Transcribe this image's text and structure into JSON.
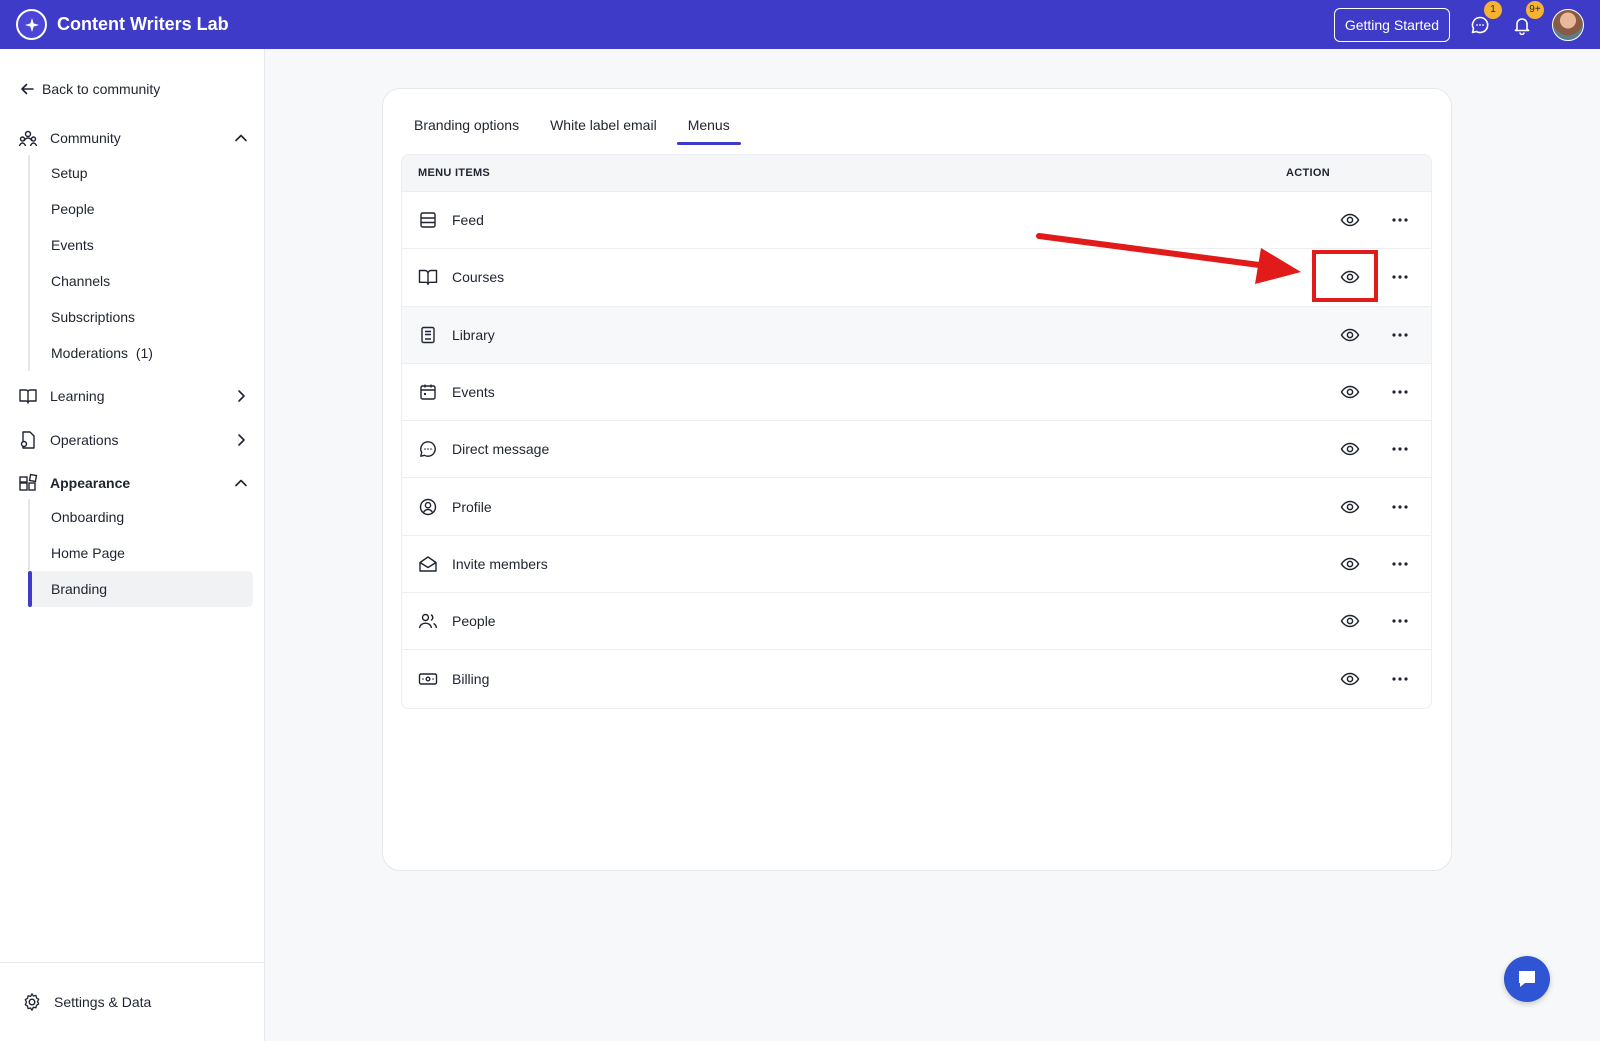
{
  "app": {
    "title": "Content Writers Lab",
    "getting_started": "Getting Started",
    "messages_badge": "1",
    "notifications_badge": "9+"
  },
  "sidebar": {
    "back": "Back to community",
    "community": {
      "label": "Community",
      "items": [
        "Setup",
        "People",
        "Events",
        "Channels",
        "Subscriptions",
        "Moderations  (1)"
      ]
    },
    "learning": "Learning",
    "operations": "Operations",
    "appearance": {
      "label": "Appearance",
      "items": [
        "Onboarding",
        "Home Page",
        "Branding"
      ]
    },
    "settings": "Settings & Data"
  },
  "tabs": [
    "Branding options",
    "White label email",
    "Menus"
  ],
  "table": {
    "col_items": "MENU ITEMS",
    "col_action": "ACTION",
    "rows": [
      {
        "label": "Feed",
        "icon": "feed-icon"
      },
      {
        "label": "Courses",
        "icon": "book-open-icon"
      },
      {
        "label": "Library",
        "icon": "library-icon"
      },
      {
        "label": "Events",
        "icon": "calendar-icon"
      },
      {
        "label": "Direct message",
        "icon": "chat-bubble-icon"
      },
      {
        "label": "Profile",
        "icon": "user-circle-icon"
      },
      {
        "label": "Invite members",
        "icon": "envelope-open-icon"
      },
      {
        "label": "People",
        "icon": "users-icon"
      },
      {
        "label": "Billing",
        "icon": "banknote-icon"
      }
    ]
  },
  "colors": {
    "brand": "#3d3bc8",
    "annotation": "#e11a1a",
    "badge": "#f5b331"
  }
}
